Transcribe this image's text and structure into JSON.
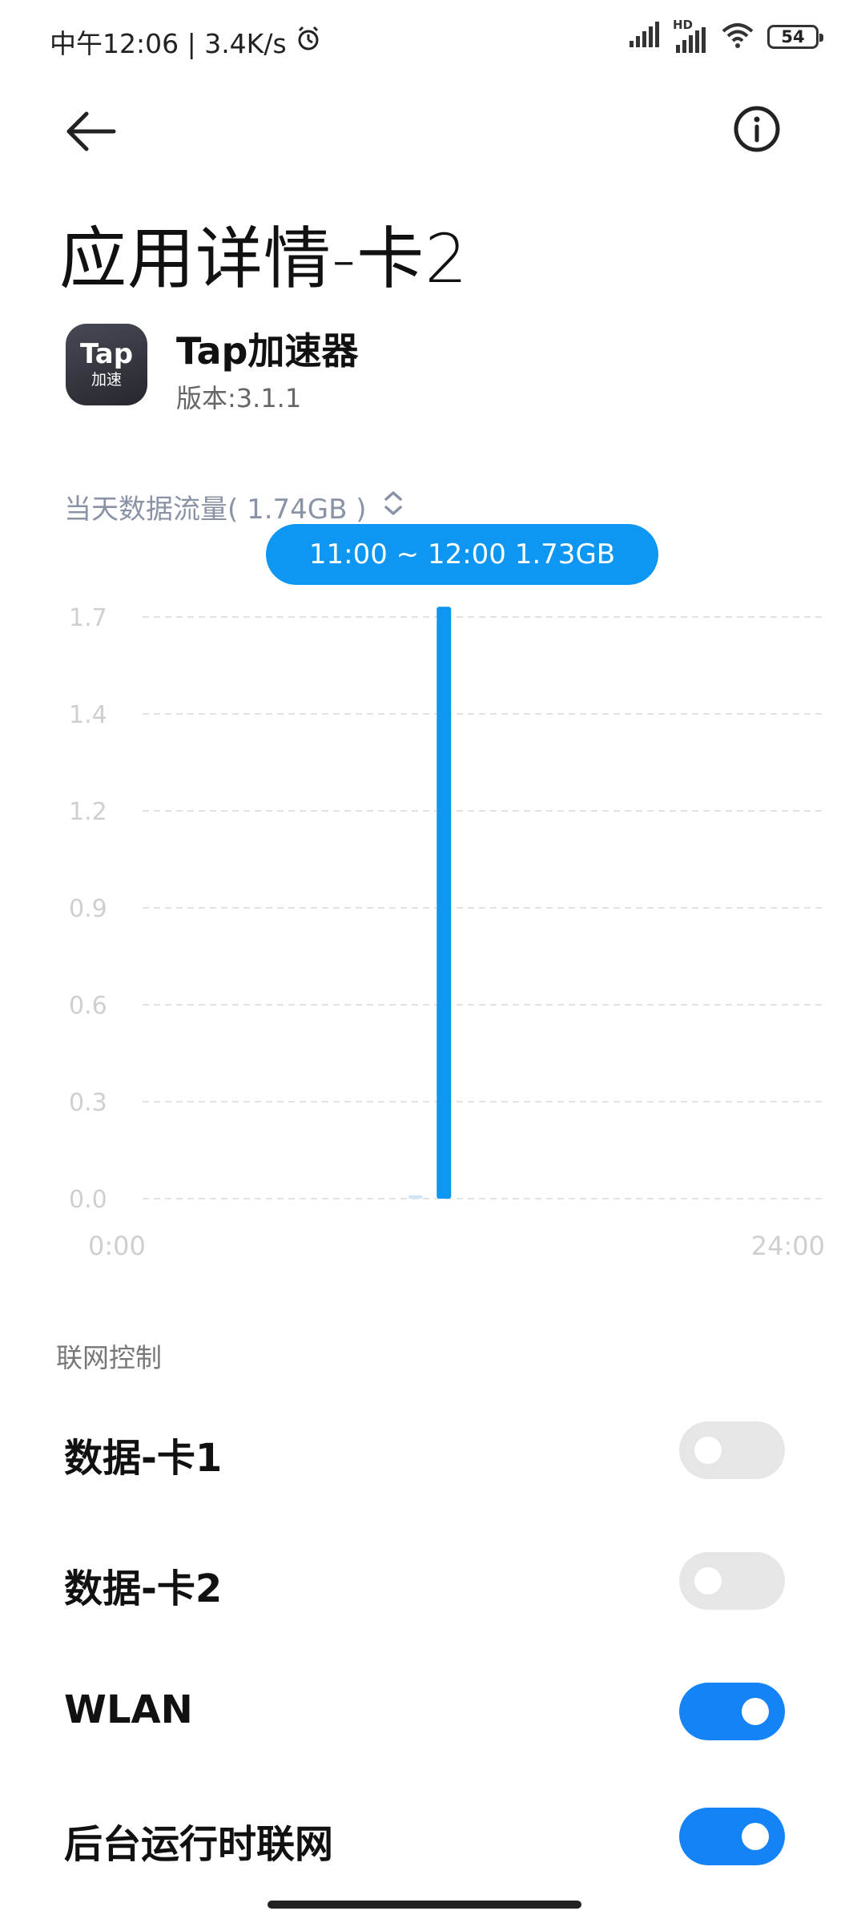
{
  "status_bar": {
    "time_text": "中午12:06 | 3.4K/s",
    "battery": "54",
    "hd_label": "HD"
  },
  "nav": {
    "back_icon": "back-arrow-icon",
    "info_icon": "info-icon"
  },
  "page": {
    "title": "应用详情-卡2"
  },
  "app": {
    "icon_word": "Tap",
    "icon_sub": "加速",
    "name": "Tap加速器",
    "version": "版本:3.1.1"
  },
  "traffic": {
    "label": "当天数据流量( 1.74GB )"
  },
  "tooltip": {
    "text": "11:00 ~ 12:00 1.73GB"
  },
  "colors": {
    "accent": "#0d96f2",
    "toggle_on": "#1483f5",
    "toggle_off": "#e6e6e6",
    "axis_text": "#cfcfcf",
    "grid": "#e3e3e3"
  },
  "chart_data": {
    "type": "bar",
    "x_start_label": "0:00",
    "x_end_label": "24:00",
    "y_ticks": [
      "0.0",
      "0.3",
      "0.6",
      "0.9",
      "1.2",
      "1.4",
      "1.7"
    ],
    "ylim": [
      0,
      1.7
    ],
    "grid": true,
    "hours": [
      0,
      1,
      2,
      3,
      4,
      5,
      6,
      7,
      8,
      9,
      10,
      11,
      12,
      13,
      14,
      15,
      16,
      17,
      18,
      19,
      20,
      21,
      22,
      23
    ],
    "values": [
      0,
      0,
      0,
      0,
      0,
      0,
      0,
      0,
      0,
      0,
      0.01,
      1.73,
      0,
      0,
      0,
      0,
      0,
      0,
      0,
      0,
      0,
      0,
      0,
      0
    ],
    "highlight_hour": 11
  },
  "network_control": {
    "header": "联网控制",
    "items": [
      {
        "label": "数据-卡1",
        "on": false
      },
      {
        "label": "数据-卡2",
        "on": false
      },
      {
        "label": "WLAN",
        "on": true
      },
      {
        "label": "后台运行时联网",
        "on": true
      }
    ]
  }
}
